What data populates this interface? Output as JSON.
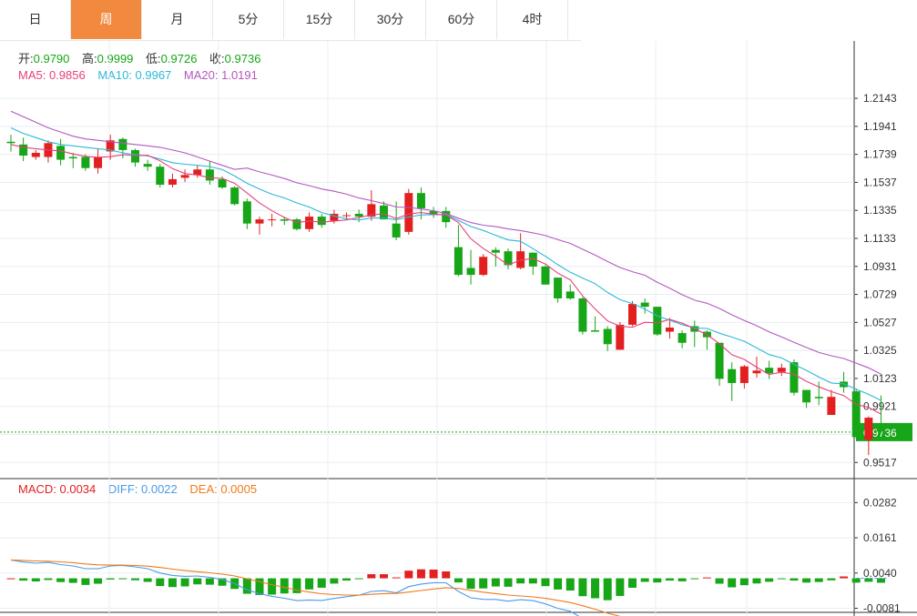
{
  "tabs": [
    "日",
    "周",
    "月",
    "5分",
    "15分",
    "30分",
    "60分",
    "4时"
  ],
  "active_tab": 1,
  "ohlc_legend": {
    "open_label": "开:",
    "open": "0.9790",
    "high_label": "高:",
    "high": "0.9999",
    "low_label": "低:",
    "low": "0.9726",
    "close_label": "收:",
    "close": "0.9736"
  },
  "ma_legend": {
    "ma5": "MA5: 0.9856",
    "ma10": "MA10: 0.9967",
    "ma20": "MA20: 1.0191"
  },
  "macd_legend": {
    "macd": "MACD: 0.0034",
    "diff": "DIFF: 0.0022",
    "dea": "DEA: 0.0005"
  },
  "colors": {
    "up": "#e32020",
    "down": "#17a617",
    "ma5": "#e8407a",
    "ma10": "#2bb8d8",
    "ma20": "#b556c1",
    "diff": "#4a9be8",
    "dea": "#ef7a1a",
    "grid": "#e8edf2",
    "last_price_tag": "#17a617",
    "active_tab": "#f1893f"
  },
  "chart_data": {
    "type": "candlestick",
    "price_axis": {
      "ticks": [
        "1.2143",
        "1.1941",
        "1.1739",
        "1.1537",
        "1.1335",
        "1.1133",
        "1.0931",
        "1.0729",
        "1.0527",
        "1.0325",
        "1.0123",
        "0.9921",
        "0.9719",
        "0.9517"
      ],
      "range": [
        0.944,
        1.236
      ]
    },
    "last_price": "0.9736",
    "macd_axis": {
      "ticks": [
        "0.0282",
        "0.0161",
        "0.0040",
        "-0.0081"
      ],
      "range": [
        -0.0095,
        0.0305
      ]
    },
    "candles": [
      [
        1.183,
        1.182,
        1.188,
        1.176
      ],
      [
        1.181,
        1.173,
        1.186,
        1.169
      ],
      [
        1.172,
        1.175,
        1.177,
        1.17
      ],
      [
        1.172,
        1.182,
        1.184,
        1.168
      ],
      [
        1.18,
        1.17,
        1.185,
        1.166
      ],
      [
        1.172,
        1.171,
        1.175,
        1.164
      ],
      [
        1.172,
        1.164,
        1.174,
        1.162
      ],
      [
        1.164,
        1.172,
        1.178,
        1.16
      ],
      [
        1.176,
        1.184,
        1.188,
        1.17
      ],
      [
        1.185,
        1.177,
        1.186,
        1.171
      ],
      [
        1.177,
        1.168,
        1.178,
        1.165
      ],
      [
        1.167,
        1.165,
        1.17,
        1.162
      ],
      [
        1.165,
        1.152,
        1.167,
        1.15
      ],
      [
        1.152,
        1.156,
        1.16,
        1.15
      ],
      [
        1.157,
        1.159,
        1.163,
        1.154
      ],
      [
        1.159,
        1.163,
        1.166,
        1.157
      ],
      [
        1.163,
        1.155,
        1.169,
        1.152
      ],
      [
        1.156,
        1.15,
        1.158,
        1.149
      ],
      [
        1.15,
        1.138,
        1.151,
        1.137
      ],
      [
        1.14,
        1.124,
        1.142,
        1.12
      ],
      [
        1.124,
        1.127,
        1.129,
        1.116
      ],
      [
        1.127,
        1.127,
        1.131,
        1.122
      ],
      [
        1.127,
        1.126,
        1.129,
        1.123
      ],
      [
        1.127,
        1.12,
        1.128,
        1.119
      ],
      [
        1.12,
        1.129,
        1.132,
        1.118
      ],
      [
        1.129,
        1.123,
        1.131,
        1.121
      ],
      [
        1.126,
        1.131,
        1.134,
        1.124
      ],
      [
        1.13,
        1.13,
        1.132,
        1.127
      ],
      [
        1.131,
        1.129,
        1.134,
        1.125
      ],
      [
        1.129,
        1.138,
        1.148,
        1.126
      ],
      [
        1.137,
        1.127,
        1.14,
        1.127
      ],
      [
        1.124,
        1.114,
        1.14,
        1.112
      ],
      [
        1.118,
        1.146,
        1.149,
        1.116
      ],
      [
        1.146,
        1.135,
        1.15,
        1.127
      ],
      [
        1.133,
        1.131,
        1.136,
        1.128
      ],
      [
        1.133,
        1.125,
        1.136,
        1.121
      ],
      [
        1.107,
        1.087,
        1.123,
        1.086
      ],
      [
        1.092,
        1.087,
        1.105,
        1.08
      ],
      [
        1.087,
        1.1,
        1.102,
        1.086
      ],
      [
        1.105,
        1.103,
        1.107,
        1.093
      ],
      [
        1.104,
        1.094,
        1.106,
        1.091
      ],
      [
        1.092,
        1.104,
        1.117,
        1.091
      ],
      [
        1.103,
        1.093,
        1.103,
        1.087
      ],
      [
        1.093,
        1.08,
        1.094,
        1.08
      ],
      [
        1.085,
        1.07,
        1.085,
        1.067
      ],
      [
        1.075,
        1.07,
        1.08,
        1.069
      ],
      [
        1.07,
        1.046,
        1.071,
        1.044
      ],
      [
        1.047,
        1.046,
        1.057,
        1.046
      ],
      [
        1.048,
        1.037,
        1.05,
        1.032
      ],
      [
        1.033,
        1.051,
        1.053,
        1.033
      ],
      [
        1.051,
        1.066,
        1.068,
        1.05
      ],
      [
        1.067,
        1.064,
        1.07,
        1.059
      ],
      [
        1.064,
        1.044,
        1.064,
        1.043
      ],
      [
        1.046,
        1.049,
        1.056,
        1.041
      ],
      [
        1.045,
        1.038,
        1.047,
        1.034
      ],
      [
        1.05,
        1.046,
        1.054,
        1.035
      ],
      [
        1.046,
        1.042,
        1.047,
        1.033
      ],
      [
        1.038,
        1.012,
        1.038,
        1.007
      ],
      [
        1.019,
        1.009,
        1.024,
        0.996
      ],
      [
        1.009,
        1.021,
        1.022,
        1.005
      ],
      [
        1.016,
        1.018,
        1.028,
        1.013
      ],
      [
        1.02,
        1.016,
        1.025,
        1.012
      ],
      [
        1.017,
        1.02,
        1.023,
        1.014
      ],
      [
        1.024,
        1.002,
        1.026,
        1.0
      ],
      [
        1.004,
        0.995,
        1.004,
        0.991
      ],
      [
        0.999,
        0.998,
        1.01,
        0.993
      ],
      [
        0.986,
        0.999,
        1.004,
        0.986
      ],
      [
        1.01,
        1.006,
        1.017,
        1.002
      ],
      [
        1.003,
        0.97,
        1.005,
        0.969
      ],
      [
        0.968,
        0.984,
        0.985,
        0.957
      ],
      [
        0.979,
        0.974,
        1.0,
        0.973
      ]
    ],
    "ma5": [
      null,
      null,
      null,
      null,
      1.1775,
      1.1759,
      1.1725,
      1.1713,
      1.1699,
      1.1724,
      1.1742,
      1.174,
      1.1683,
      1.16,
      1.1584,
      1.157,
      1.1569,
      1.1551,
      1.1519,
      1.1419,
      1.1349,
      1.1297,
      1.1288,
      1.1292,
      1.1262,
      1.1255,
      1.126,
      1.1253,
      1.127,
      1.1293,
      1.1298,
      1.1276,
      1.1282,
      1.1282,
      1.132,
      1.13,
      1.1191,
      1.1108,
      1.1034,
      1.0914,
      1.0939,
      1.0952,
      1.0943,
      1.0853,
      1.0849,
      1.0778,
      1.0711,
      1.062,
      1.056,
      1.0513,
      1.0483,
      1.0515,
      1.0598,
      1.0548,
      1.0432,
      1.0493,
      1.0415,
      1.0406,
      1.0308,
      1.0225,
      1.0185,
      1.0129,
      1.0211,
      1.0086,
      1.0025,
      0.9965,
      0.9985,
      0.9999,
      0.9988,
      0.9972,
      0.9927
    ],
    "ma10": [
      null,
      null,
      null,
      null,
      null,
      null,
      null,
      null,
      null,
      1.1776,
      1.1768,
      1.1753,
      1.1722,
      1.1704,
      1.1654,
      1.1642,
      1.1575,
      1.1563,
      1.1497,
      1.1399,
      1.1374,
      1.1359,
      1.129,
      1.123,
      1.1245,
      1.1218,
      1.1218,
      1.1225,
      1.1203,
      1.1233,
      1.1256,
      1.1241,
      1.1237,
      1.1262,
      1.1287,
      1.1297,
      1.1285,
      1.1251,
      1.1214,
      1.1151,
      1.1117,
      1.107,
      1.0988,
      1.0984,
      1.0873,
      1.0858,
      1.0831,
      1.0779,
      1.0732,
      1.0673,
      1.0605,
      1.0555,
      1.0511,
      1.0528,
      1.0502,
      1.0451,
      1.0481,
      1.0485,
      1.0455,
      1.039,
      1.0306,
      1.0278,
      1.0237,
      1.0204,
      1.0142,
      1.0133,
      1.0083,
      1.0059,
      1.0053,
      0.9998,
      1.0003
    ]
  }
}
